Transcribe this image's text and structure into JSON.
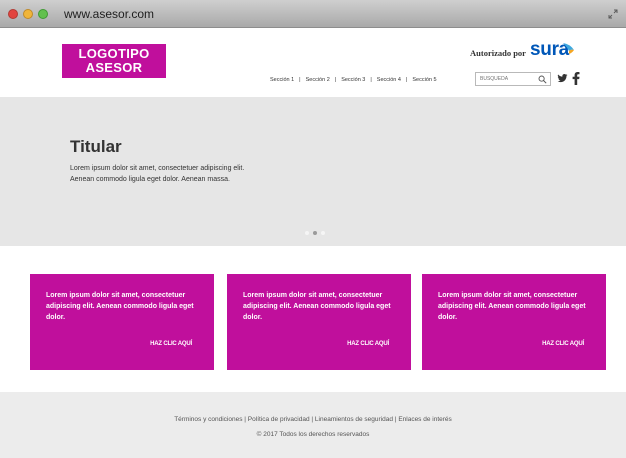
{
  "browser": {
    "url": "www.asesor.com"
  },
  "header": {
    "logo_line1": "LOGOTIPO",
    "logo_line2": "ASESOR",
    "authorized_label": "Autorizado por",
    "brand_name": "sura",
    "nav": [
      {
        "label": "Sección 1"
      },
      {
        "label": "Sección 2"
      },
      {
        "label": "Sección 3"
      },
      {
        "label": "Sección 4"
      },
      {
        "label": "Sección 5"
      }
    ],
    "nav_separator": "|",
    "search_placeholder": "BÚSQUEDA"
  },
  "hero": {
    "title": "Titular",
    "body": "Lorem ipsum dolor sit amet, consectetuer adipiscing elit. Aenean commodo ligula eget dolor. Aenean massa.",
    "slides": 3,
    "active_slide": 2
  },
  "cards": [
    {
      "text": "Lorem ipsum dolor sit amet, consectetuer adipiscing elit. Aenean commodo ligula eget dolor.",
      "cta": "HAZ CLIC AQUÍ"
    },
    {
      "text": "Lorem ipsum dolor sit amet, consectetuer adipiscing elit. Aenean commodo ligula eget dolor.",
      "cta": "HAZ CLIC AQUÍ"
    },
    {
      "text": "Lorem ipsum dolor sit amet, consectetuer adipiscing elit. Aenean commodo ligula eget dolor.",
      "cta": "HAZ CLIC AQUÍ"
    }
  ],
  "footer": {
    "links": [
      {
        "label": "Términos y condiciones"
      },
      {
        "label": "Política de privacidad"
      },
      {
        "label": "Lineamientos de seguridad"
      },
      {
        "label": "Enlaces de interés"
      }
    ],
    "link_separator": "|",
    "copyright": "© 2017 Todos los derechos reservados"
  },
  "colors": {
    "brand_magenta": "#c00f9c",
    "sura_blue": "#0057b8",
    "hero_background": "#e6e6e6",
    "footer_background": "#ececec"
  },
  "icons": [
    "close-window-icon",
    "minimize-window-icon",
    "maximize-window-icon",
    "fullscreen-icon",
    "sura-logo-icon",
    "search-icon",
    "twitter-icon",
    "facebook-icon"
  ]
}
